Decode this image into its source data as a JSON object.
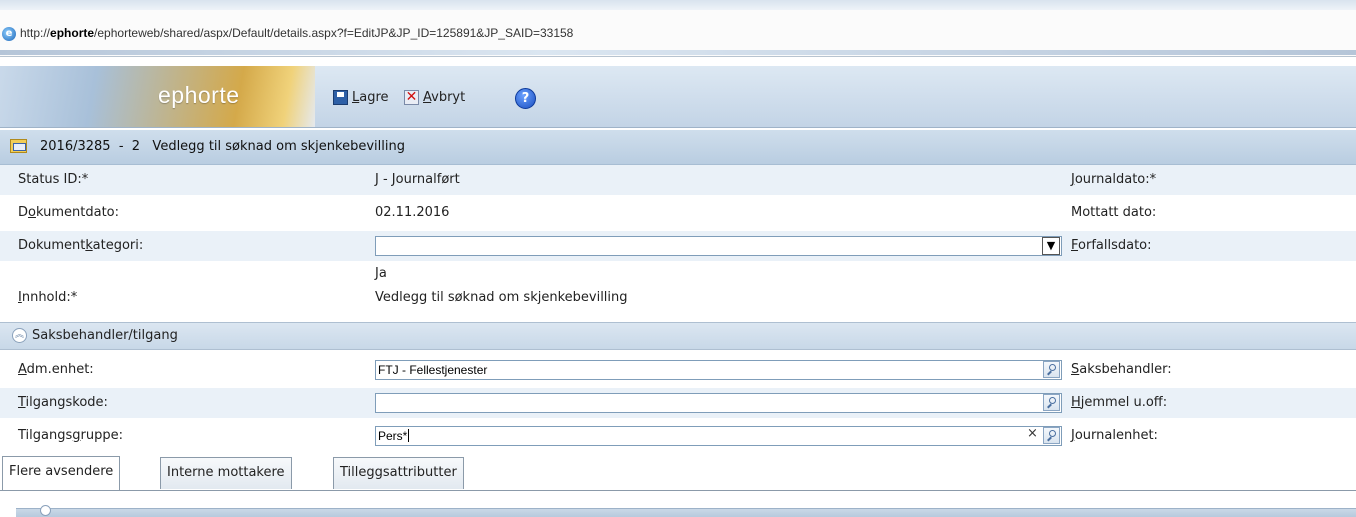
{
  "browser": {
    "url_prefix": "http://",
    "url_host": "ephorte",
    "url_rest": "/ephorteweb/shared/aspx/Default/details.aspx?f=EditJP&JP_ID=125891&JP_SAID=33158"
  },
  "toolbar": {
    "logo": "ephorte",
    "save_label": "Lagre",
    "cancel_label": "Avbryt",
    "help_glyph": "?"
  },
  "title": "2016/3285  -  2   Vedlegg til søknad om skjenkebevilling",
  "form": {
    "status": {
      "label": "Status ID:*",
      "value": "J - Journalført",
      "right_label": "Journaldato:*"
    },
    "dokumentdato": {
      "label_pre": "D",
      "label_u": "o",
      "label_post": "kumentdato:",
      "value": "02.11.2016",
      "right_label": "Mottatt dato:"
    },
    "kategori": {
      "label_pre": "Dokument",
      "label_u": "k",
      "label_post": "ategori:",
      "value": "",
      "right_label": "Forfallsdato:"
    },
    "ja": {
      "value": "Ja"
    },
    "innhold": {
      "label": "Innhold:*",
      "value": "Vedlegg til søknad om skjenkebevilling"
    }
  },
  "section": {
    "title": "Saksbehandler/tilgang",
    "chevron": "︽"
  },
  "access": {
    "adm": {
      "label": "Adm.enhet:",
      "value": "FTJ - Fellestjenester",
      "right_label": "Saksbehandler:"
    },
    "tilgangskode": {
      "label": "Tilgangskode:",
      "value": "",
      "right_label": "Hjemmel u.off:"
    },
    "tilgangsgruppe": {
      "label_pre": "Tilgangs",
      "label_u": "g",
      "label_post": "ruppe:",
      "value": "Pers*",
      "clear": "×",
      "right_label": "Journalenhet:"
    }
  },
  "tabs": [
    "Flere avsendere",
    "Interne mottakere",
    "Tilleggsattributter"
  ],
  "colors": {
    "accent": "#c3d4e6",
    "row_alt": "#eaf1f8",
    "border": "#7f9db9"
  }
}
